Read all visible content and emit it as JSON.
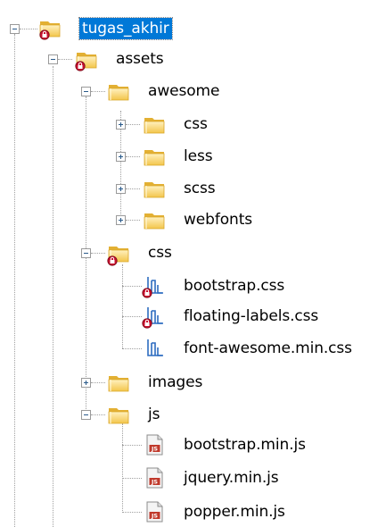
{
  "tree": {
    "root": {
      "label": "tugas_akhir",
      "expanded": true,
      "selected": true,
      "badge": true
    },
    "assets": {
      "label": "assets",
      "expanded": true,
      "badge": true
    },
    "awesome": {
      "label": "awesome",
      "expanded": true
    },
    "awesome_css": {
      "label": "css",
      "expanded": false
    },
    "awesome_less": {
      "label": "less",
      "expanded": false
    },
    "awesome_scss": {
      "label": "scss",
      "expanded": false
    },
    "awesome_webfonts": {
      "label": "webfonts",
      "expanded": false
    },
    "css": {
      "label": "css",
      "expanded": true,
      "badge": true
    },
    "bootstrap_css": {
      "label": "bootstrap.css",
      "badge": true
    },
    "floating_labels_css": {
      "label": "floating-labels.css",
      "badge": true
    },
    "font_awesome_min_css": {
      "label": "font-awesome.min.css"
    },
    "images": {
      "label": "images",
      "expanded": false
    },
    "js": {
      "label": "js",
      "expanded": true
    },
    "bootstrap_min_js": {
      "label": "bootstrap.min.js"
    },
    "jquery_min_js": {
      "label": "jquery.min.js"
    },
    "popper_min_js": {
      "label": "popper.min.js"
    }
  },
  "icons": {
    "folder": "folder-icon",
    "css_file": "css-file-icon",
    "js_file": "js-file-icon",
    "badge": "error-badge-icon"
  },
  "colors": {
    "selection": "#0078d7",
    "folder_light": "#fde59a",
    "folder_dark": "#e3b033",
    "badge": "#c8102e",
    "css_icon": "#2d6cc0",
    "js_icon": "#c0392b"
  }
}
